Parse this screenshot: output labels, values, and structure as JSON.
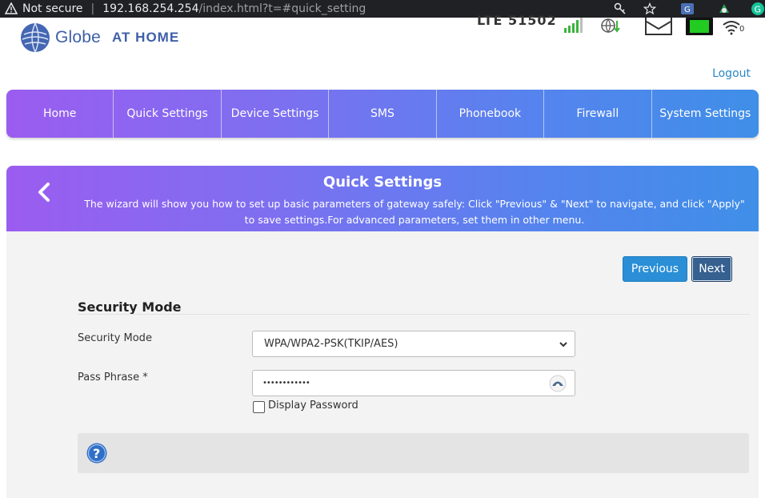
{
  "browser": {
    "security_label": "Not secure",
    "url_host": "192.168.254.254",
    "url_path": "/index.html?t=#quick_setting",
    "icons": [
      "key-icon",
      "bookmark-star-icon",
      "extension-icon",
      "extension-icon-2",
      "grammarly-icon"
    ]
  },
  "header": {
    "brand": "Globe",
    "brand_sub": "AT HOME",
    "network_type": "LTE 51502",
    "wifi_clients": "0",
    "logout_label": "Logout"
  },
  "nav": {
    "items": [
      {
        "label": "Home"
      },
      {
        "label": "Quick Settings"
      },
      {
        "label": "Device Settings"
      },
      {
        "label": "SMS"
      },
      {
        "label": "Phonebook"
      },
      {
        "label": "Firewall"
      },
      {
        "label": "System Settings"
      }
    ]
  },
  "banner": {
    "title": "Quick Settings",
    "description": "The wizard will show you how to set up basic parameters of gateway safely: Click \"Previous\" & \"Next\" to navigate, and click \"Apply\" to save settings.For advanced parameters, set them in other menu."
  },
  "wizard": {
    "previous_label": "Previous",
    "next_label": "Next",
    "section_title": "Security Mode",
    "security_mode_label": "Security Mode",
    "security_mode_value": "WPA/WPA2-PSK(TKIP/AES)",
    "pass_phrase_label": "Pass Phrase *",
    "pass_phrase_masked": "••••••••••••",
    "display_password_label": "Display Password",
    "display_password_checked": false
  },
  "colors": {
    "gradient_start": "#9b5cf0",
    "gradient_end": "#3f8fe8",
    "brand_blue": "#3f5fa8",
    "link_blue": "#2a87c8",
    "signal_green": "#3cb43c",
    "battery_green": "#22cc22"
  }
}
